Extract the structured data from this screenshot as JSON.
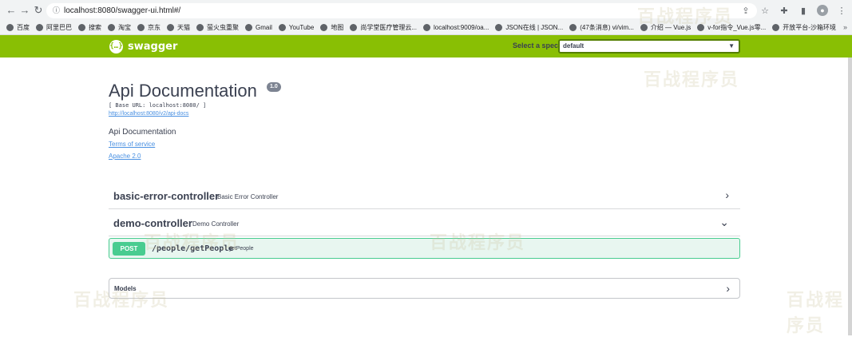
{
  "browser": {
    "url": "localhost:8080/swagger-ui.html#/",
    "bookmarks": [
      "百度",
      "阿里巴巴",
      "搜索",
      "淘宝",
      "京东",
      "天猫",
      "萤火虫重聚",
      "Gmail",
      "YouTube",
      "地图",
      "尚学堂医疗管理云...",
      "localhost:9009/oa...",
      "JSON在线 | JSON...",
      "(47条消息) vi/vim...",
      "介绍 — Vue.js",
      "v-for指令_Vue.js零...",
      "开放平台-沙箱环境"
    ],
    "bookmarks_more": "»"
  },
  "topbar": {
    "logo_symbol": "{…}",
    "logo_text": "swagger",
    "spec_label": "Select a spec",
    "spec_value": "default",
    "color": "#89bf04"
  },
  "info": {
    "title": "Api Documentation",
    "version": "1.0",
    "base_url": "[ Base URL: localhost:8080/ ]",
    "docs_url": "http://localhost:8080/v2/api-docs",
    "description": "Api Documentation",
    "terms": "Terms of service",
    "license": "Apache 2.0"
  },
  "tags": [
    {
      "name": "basic-error-controller",
      "description": "Basic Error Controller",
      "arrow": "›",
      "expanded": false
    },
    {
      "name": "demo-controller",
      "description": "Demo Controller",
      "arrow": "⌄",
      "expanded": true
    }
  ],
  "operation": {
    "method": "POST",
    "path": "/people/getPeople",
    "summary": "getPeople",
    "color": "#49cc90"
  },
  "models": {
    "title": "Models",
    "arrow": "›"
  },
  "watermark": "百战程序员"
}
